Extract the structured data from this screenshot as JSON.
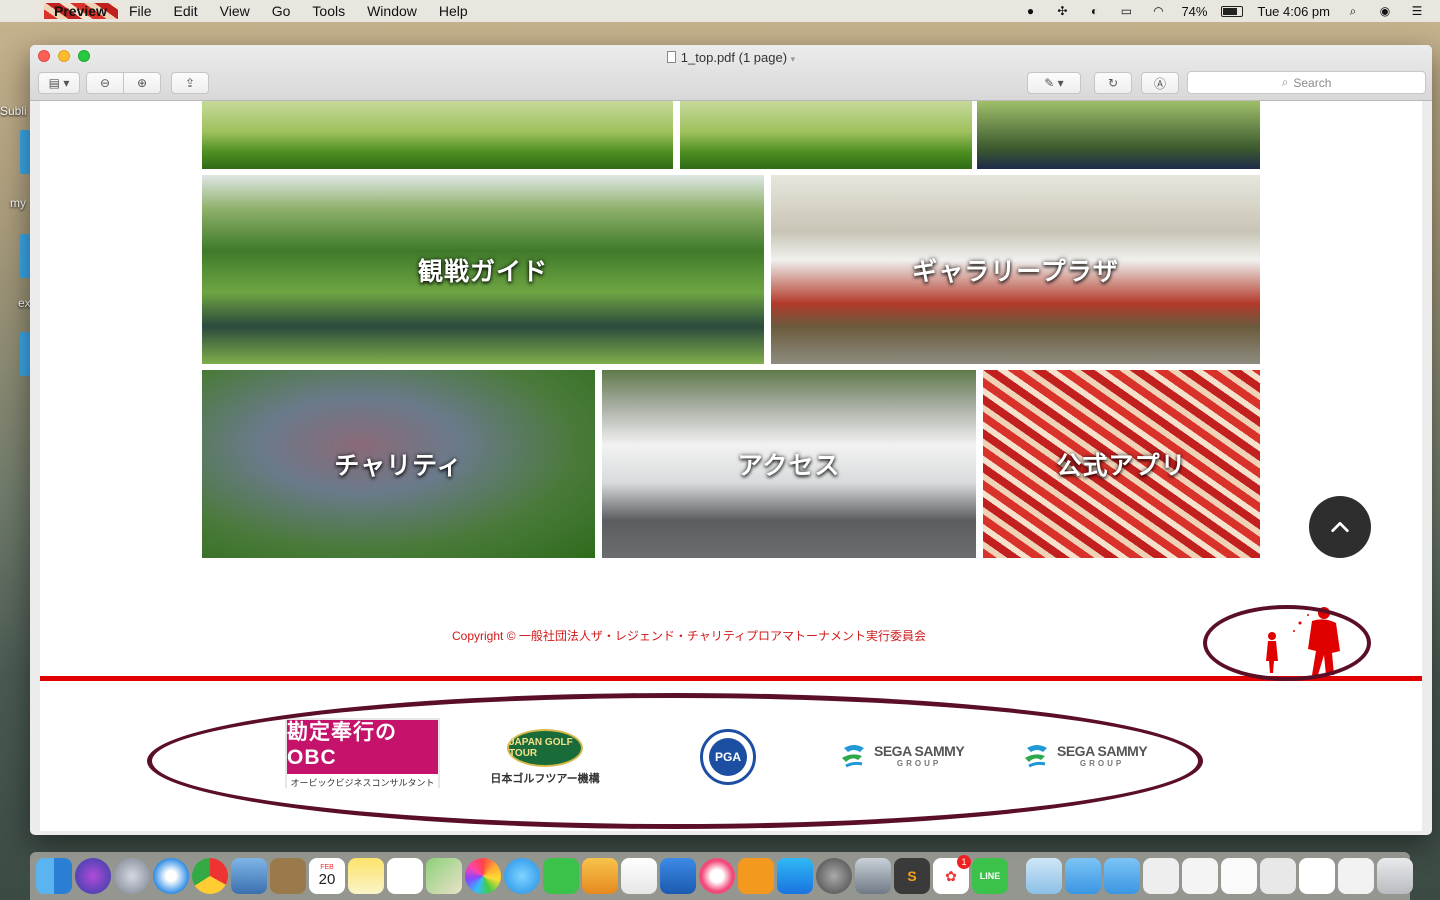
{
  "menubar": {
    "app_name": "Preview",
    "menus": [
      "File",
      "Edit",
      "View",
      "Go",
      "Tools",
      "Window",
      "Help"
    ],
    "battery": "74%",
    "clock": "Tue 4:06 pm"
  },
  "desktop": {
    "labels": [
      "Subli",
      "my",
      "ex"
    ]
  },
  "window": {
    "title": "1_top.pdf (1 page)",
    "search_placeholder": "Search"
  },
  "document": {
    "tiles": [
      {
        "label": "観戦ガイド"
      },
      {
        "label": "ギャラリープラザ"
      },
      {
        "label": "チャリティ"
      },
      {
        "label": "アクセス"
      },
      {
        "label": "公式アプリ"
      }
    ],
    "copyright": "Copyright © 一般社団法人ザ・レジェンド・チャリティプロアマトーナメント実行委員会",
    "sponsors": {
      "obc_big": "勘定奉行のOBC",
      "obc_small": "オービックビジネスコンサルタント",
      "jgto_mark": "JAPAN GOLF TOUR",
      "jgto_caption": "日本ゴルフツアー機構",
      "pga_mark": "PGA",
      "sega_name": "SEGA SAMMY",
      "sega_group": "GROUP"
    }
  },
  "dock": {
    "calendar_month": "FEB",
    "calendar_day": "20",
    "badge_count": "1"
  },
  "colors": {
    "accent_red": "#e00000",
    "annotation_maroon": "#5a0f26",
    "obc_magenta": "#c5126a"
  }
}
